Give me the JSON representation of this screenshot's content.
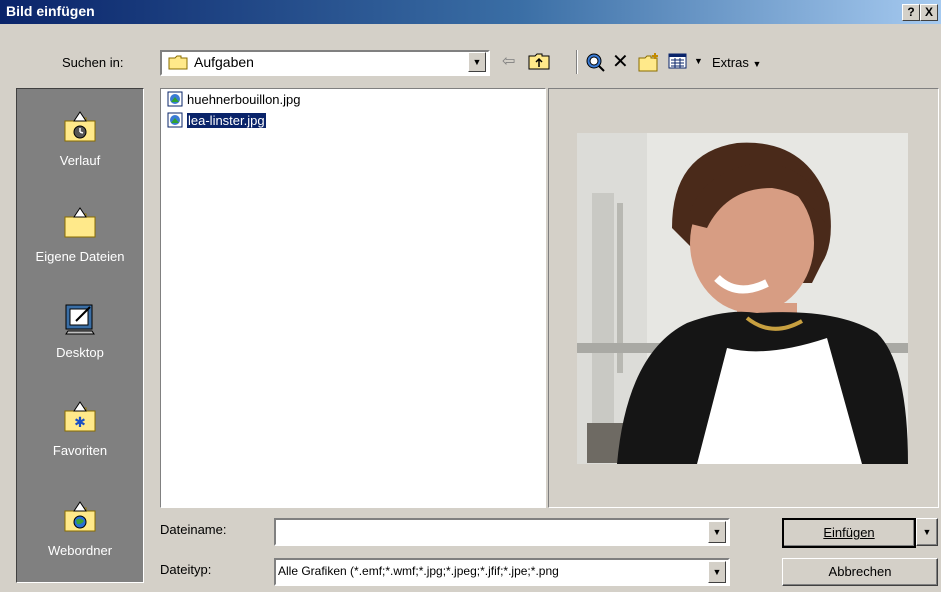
{
  "dialog": {
    "title": "Bild einfügen",
    "help_label": "?",
    "close_label": "X"
  },
  "toolbar": {
    "lookin_label": "Suchen in:",
    "lookin_value": "Aufgaben",
    "back_icon": "back-arrow-icon",
    "up_icon": "up-folder-icon",
    "search_web_icon": "search-web-icon",
    "delete_icon": "delete-icon",
    "new_folder_icon": "new-folder-icon",
    "views_icon": "views-icon",
    "extras_label": "Extras"
  },
  "places": [
    {
      "label": "Verlauf",
      "icon": "history-icon"
    },
    {
      "label": "Eigene Dateien",
      "icon": "my-documents-icon"
    },
    {
      "label": "Desktop",
      "icon": "desktop-icon"
    },
    {
      "label": "Favoriten",
      "icon": "favorites-icon"
    },
    {
      "label": "Webordner",
      "icon": "web-folders-icon"
    }
  ],
  "files": [
    {
      "name": "huehnerbouillon.jpg",
      "selected": false
    },
    {
      "name": "lea-linster.jpg",
      "selected": true
    }
  ],
  "preview": {
    "description_icon": "photo-preview"
  },
  "form": {
    "filename_label": "Dateiname:",
    "filename_value": "",
    "filetype_label": "Dateityp:",
    "filetype_value": "Alle Grafiken (*.emf;*.wmf;*.jpg;*.jpeg;*.jfif;*.jpe;*.png"
  },
  "buttons": {
    "insert_label": "Einfügen",
    "cancel_label": "Abbrechen"
  },
  "colors": {
    "titlebar_start": "#0a246a",
    "titlebar_end": "#a6caf0",
    "face": "#d4d0c8",
    "selection": "#0a246a"
  }
}
